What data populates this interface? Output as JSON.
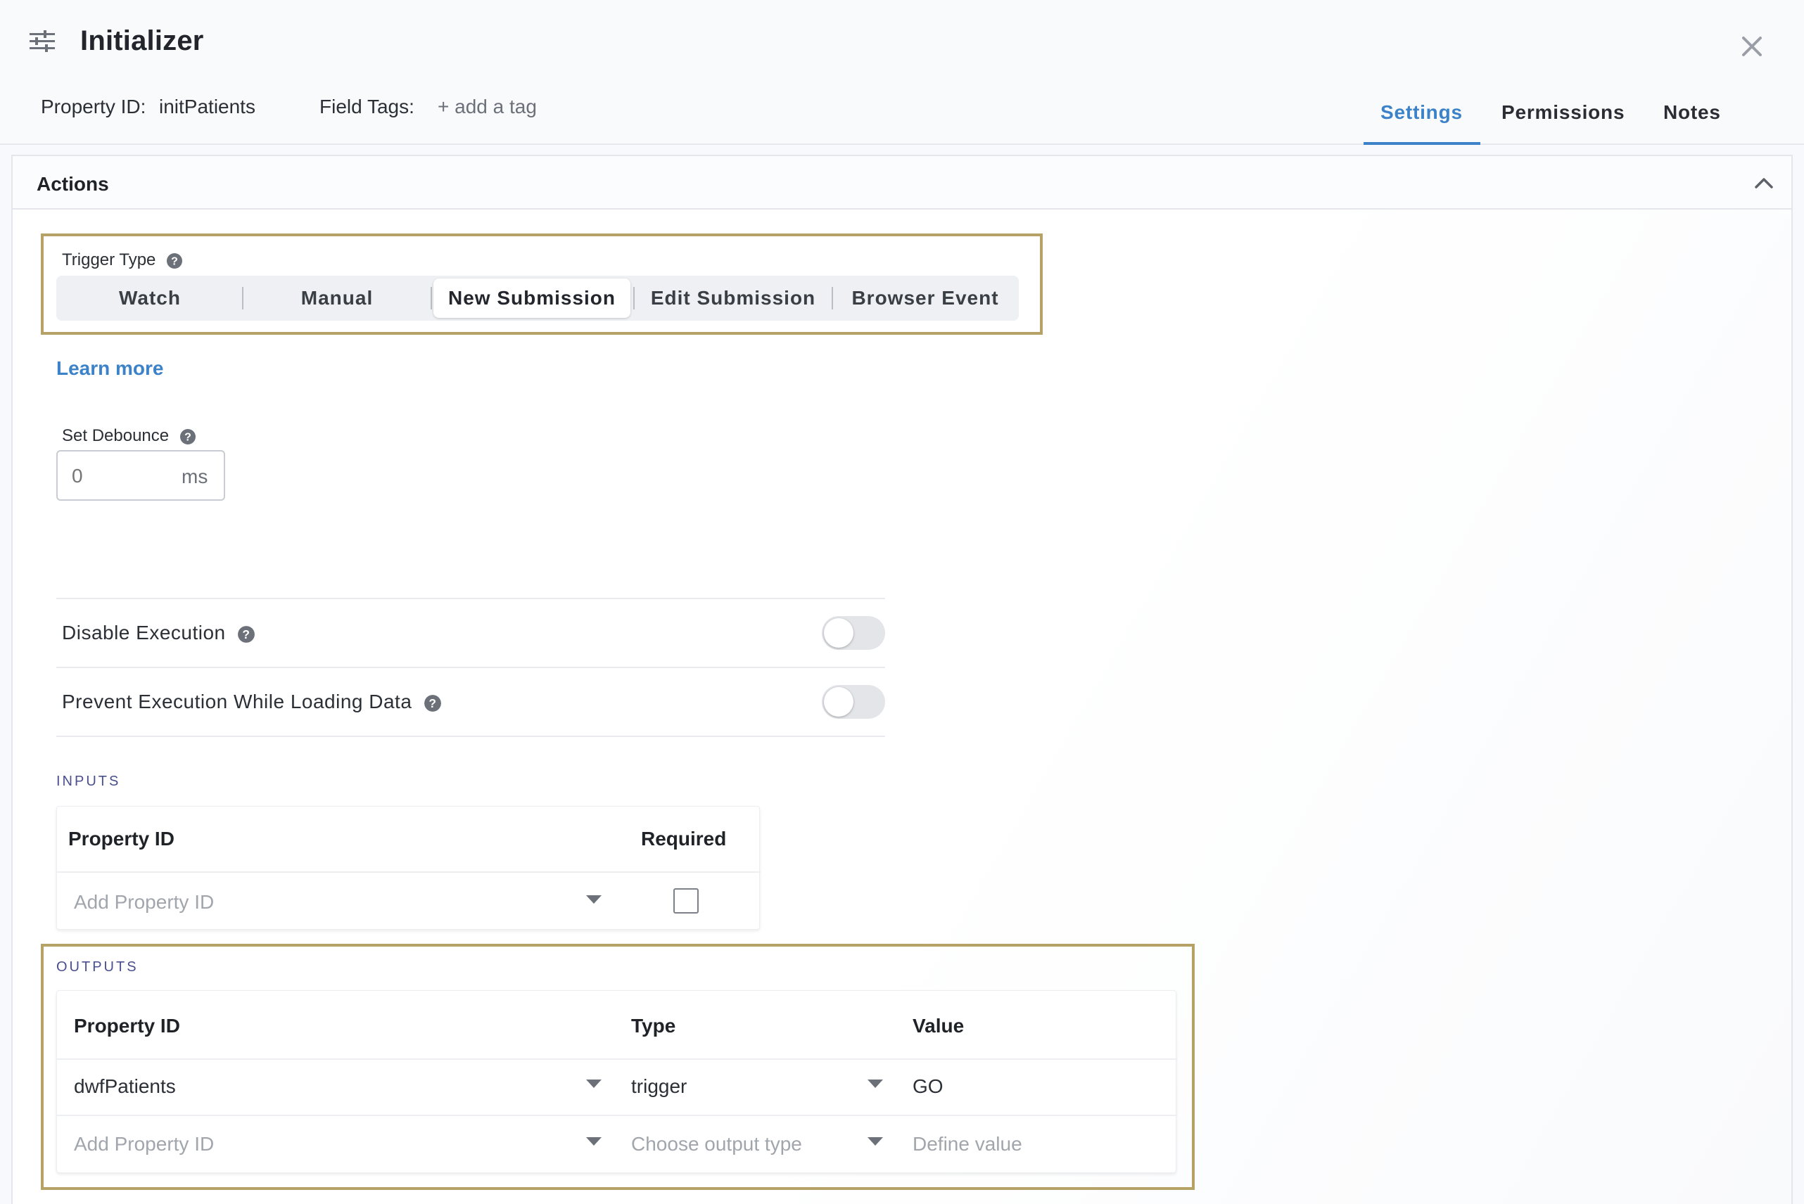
{
  "header": {
    "title": "Initializer",
    "property_id_label": "Property ID:",
    "property_id_value": "initPatients",
    "field_tags_label": "Field Tags:",
    "add_tag": "+ add a tag",
    "tabs": [
      {
        "label": "Settings",
        "active": true
      },
      {
        "label": "Permissions",
        "active": false
      },
      {
        "label": "Notes",
        "active": false
      }
    ]
  },
  "actions": {
    "title": "Actions",
    "trigger_type_label": "Trigger Type",
    "trigger_options": [
      "Watch",
      "Manual",
      "New Submission",
      "Edit Submission",
      "Browser Event"
    ],
    "trigger_selected": "New Submission",
    "learn_more": "Learn more",
    "debounce_label": "Set Debounce",
    "debounce_placeholder": "0",
    "debounce_unit": "ms",
    "toggles": [
      {
        "label": "Disable Execution",
        "on": false
      },
      {
        "label": "Prevent Execution While Loading Data",
        "on": false
      }
    ]
  },
  "inputs": {
    "section_label": "INPUTS",
    "columns": [
      "Property ID",
      "Required"
    ],
    "rows": [
      {
        "property_placeholder": "Add Property ID",
        "required": false
      }
    ]
  },
  "outputs": {
    "section_label": "OUTPUTS",
    "columns": [
      "Property ID",
      "Type",
      "Value"
    ],
    "rows": [
      {
        "property_id": "dwfPatients",
        "type": "trigger",
        "value": "GO"
      }
    ],
    "new_row": {
      "property_placeholder": "Add Property ID",
      "type_placeholder": "Choose output type",
      "value_placeholder": "Define value"
    }
  },
  "colors": {
    "accent": "#3b82c8",
    "highlight_border": "#b6a266",
    "section_label": "#4a4f8f"
  },
  "icons": [
    "menu-sliders-icon",
    "close-icon",
    "chevron-up-icon",
    "help-circle-icon",
    "caret-down-icon"
  ]
}
